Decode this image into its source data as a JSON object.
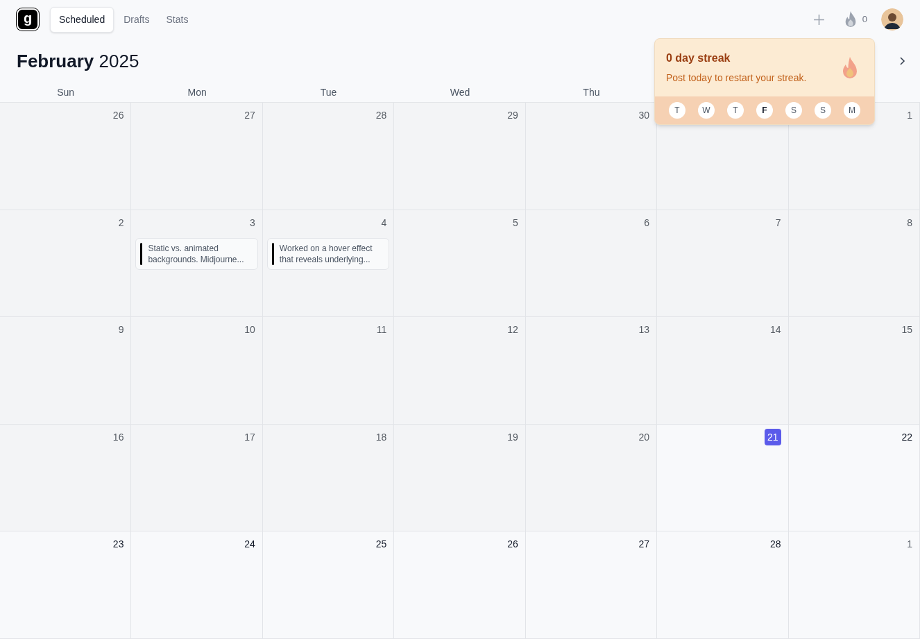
{
  "app": {
    "logo": "g"
  },
  "tabs": [
    {
      "label": "Scheduled",
      "selected": true
    },
    {
      "label": "Drafts",
      "selected": false
    },
    {
      "label": "Stats",
      "selected": false
    }
  ],
  "streak_count": "0",
  "heading": {
    "month": "February",
    "year": "2025"
  },
  "weekdays": [
    "Sun",
    "Mon",
    "Tue",
    "Wed",
    "Thu"
  ],
  "weeks": [
    [
      {
        "day": "26",
        "kind": "past"
      },
      {
        "day": "27",
        "kind": "past"
      },
      {
        "day": "28",
        "kind": "past"
      },
      {
        "day": "29",
        "kind": "past"
      },
      {
        "day": "30",
        "kind": "past"
      },
      {
        "kind": "past"
      },
      {
        "day": "1",
        "kind": "past"
      }
    ],
    [
      {
        "day": "2",
        "kind": "past"
      },
      {
        "day": "3",
        "kind": "past",
        "posts": [
          "Static vs. animated backgrounds. Midjourne..."
        ]
      },
      {
        "day": "4",
        "kind": "past",
        "posts": [
          "Worked on a hover effect that reveals underlying..."
        ]
      },
      {
        "day": "5",
        "kind": "past"
      },
      {
        "day": "6",
        "kind": "past"
      },
      {
        "day": "7",
        "kind": "past"
      },
      {
        "day": "8",
        "kind": "past"
      }
    ],
    [
      {
        "day": "9",
        "kind": "past"
      },
      {
        "day": "10",
        "kind": "past"
      },
      {
        "day": "11",
        "kind": "past"
      },
      {
        "day": "12",
        "kind": "past"
      },
      {
        "day": "13",
        "kind": "past"
      },
      {
        "day": "14",
        "kind": "past"
      },
      {
        "day": "15",
        "kind": "past"
      }
    ],
    [
      {
        "day": "16",
        "kind": "past"
      },
      {
        "day": "17",
        "kind": "past"
      },
      {
        "day": "18",
        "kind": "past"
      },
      {
        "day": "19",
        "kind": "past"
      },
      {
        "day": "20",
        "kind": "past"
      },
      {
        "day": "21",
        "kind": "today"
      },
      {
        "day": "22",
        "kind": "upcoming"
      }
    ],
    [
      {
        "day": "23",
        "kind": "upcoming"
      },
      {
        "day": "24",
        "kind": "upcoming"
      },
      {
        "day": "25",
        "kind": "upcoming"
      },
      {
        "day": "26",
        "kind": "upcoming"
      },
      {
        "day": "27",
        "kind": "upcoming"
      },
      {
        "day": "28",
        "kind": "upcoming"
      },
      {
        "day": "1",
        "kind": "next_month"
      }
    ]
  ],
  "streak_popover": {
    "title": "0 day streak",
    "message": "Post today to restart your streak.",
    "days": [
      {
        "label": "T",
        "today": false
      },
      {
        "label": "W",
        "today": false
      },
      {
        "label": "T",
        "today": false
      },
      {
        "label": "F",
        "today": true
      },
      {
        "label": "S",
        "today": false
      },
      {
        "label": "S",
        "today": false
      },
      {
        "label": "M",
        "today": false
      }
    ]
  }
}
